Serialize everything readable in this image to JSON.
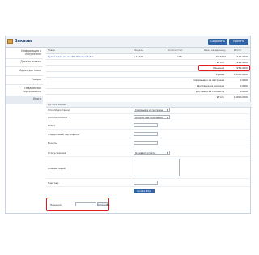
{
  "header": {
    "title": "Заказы",
    "btn_save": "Сохранить",
    "btn_delete": "Удалить"
  },
  "sidebar": {
    "items": [
      {
        "label": "Информация о покупателе"
      },
      {
        "label": "Детали оплаты"
      },
      {
        "label": "Адрес доставки"
      },
      {
        "label": "Товары"
      },
      {
        "label": "Подарочные сертификаты"
      },
      {
        "label": "Итого"
      }
    ]
  },
  "products": {
    "columns": [
      "Товар",
      "Модель",
      "Количество",
      "Цена за единицу",
      "Итого"
    ],
    "rows": [
      {
        "name": "Бумага для А4 ink ТМ \"Мелан\" 3.5 л.",
        "model": "+11220",
        "qty": "105",
        "price": "20.2000",
        "total": "2121.0000"
      }
    ],
    "totals": [
      {
        "label": "Итого",
        "value": "2121.0000"
      },
      {
        "label": "Наценка",
        "value": "2259.0000"
      },
      {
        "label": "Сумма",
        "value": "15000.0000"
      },
      {
        "label": "Самовывоз из магазина",
        "value": "0.0000"
      },
      {
        "label": "Доставка из региона",
        "value": "0.0000"
      },
      {
        "label": "Доставка из сегмента",
        "value": "0.0000"
      },
      {
        "label": "Итого",
        "value": "18000.0000"
      }
    ]
  },
  "details": {
    "section_title": "Детали заказа",
    "fields": {
      "delivery_method": {
        "label": "Способ доставки",
        "value": "Самовывоз из магазина"
      },
      "payment_method": {
        "label": "Способ оплаты",
        "value": "Оплата при получении"
      },
      "bonus": {
        "label": "Бонус",
        "value": ""
      },
      "gift_cert": {
        "label": "Подарочный сертификат",
        "value": ""
      },
      "bonuses": {
        "label": "Бонусы",
        "value": ""
      },
      "order_status": {
        "label": "Статус заказа",
        "value": "Ожидает оплаты"
      },
      "comment": {
        "label": "Комментарий",
        "value": ""
      },
      "partner": {
        "label": "Партнер",
        "value": ""
      }
    },
    "update_button": "Update Total"
  },
  "markup": {
    "label": "Наценка",
    "value": "",
    "save_button": "Сохранить"
  },
  "colors": {
    "accent": "#2f63a8",
    "highlight": "#e01e1e"
  }
}
